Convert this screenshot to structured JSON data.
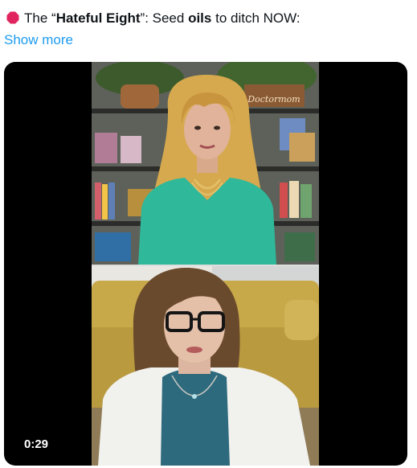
{
  "tweet": {
    "icon": "stop-sign-icon",
    "text_parts": {
      "part1": "The “",
      "part2": "Hateful Eight",
      "part3": "”: Seed ",
      "part4": "oils",
      "part5": " to ditch NOW:"
    },
    "show_more_label": "Show more"
  },
  "video": {
    "duration": "0:29",
    "panels": [
      {
        "name": "top-speaker-panel",
        "wall_sign": "Doctormom",
        "description_colors": {
          "wall": "#5d6159",
          "shirt": "#2fb89a",
          "hair": "#d7a94e"
        }
      },
      {
        "name": "bottom-speaker-panel",
        "description_colors": {
          "sofa": "#c8a94a",
          "cardigan": "#f1f1ee",
          "top": "#2e6a7d",
          "hair": "#6a4a2c"
        }
      }
    ]
  },
  "colors": {
    "link": "#1d9bf0",
    "text": "#0f1419",
    "stop_icon": "#e0245e"
  }
}
